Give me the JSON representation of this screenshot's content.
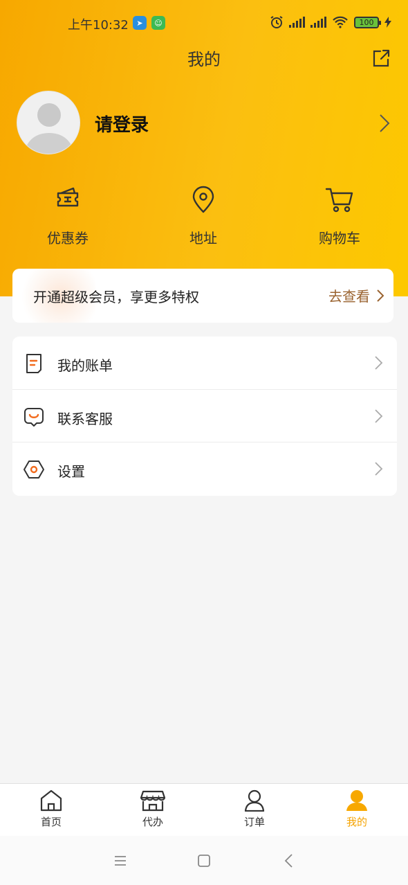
{
  "status_bar": {
    "time": "上午10:32",
    "battery": "100"
  },
  "header": {
    "title": "我的"
  },
  "profile": {
    "login_text": "请登录"
  },
  "quick_actions": [
    {
      "label": "优惠券",
      "icon": "coupon-icon"
    },
    {
      "label": "地址",
      "icon": "location-icon"
    },
    {
      "label": "购物车",
      "icon": "cart-icon"
    }
  ],
  "vip": {
    "text": "开通超级会员，享更多特权",
    "link_label": "去查看"
  },
  "menu": [
    {
      "label": "我的账单",
      "icon": "bill-icon"
    },
    {
      "label": "联系客服",
      "icon": "customer-service-icon"
    },
    {
      "label": "设置",
      "icon": "settings-icon"
    }
  ],
  "tabbar": [
    {
      "label": "首页",
      "icon": "home-icon"
    },
    {
      "label": "代办",
      "icon": "store-icon"
    },
    {
      "label": "订单",
      "icon": "order-icon"
    },
    {
      "label": "我的",
      "icon": "profile-icon",
      "active": true
    }
  ],
  "colors": {
    "brand_yellow": "#fbbf10",
    "active_tab": "#f5a300",
    "icon_accent": "#f26b1d",
    "vip_link": "#9a6330"
  }
}
